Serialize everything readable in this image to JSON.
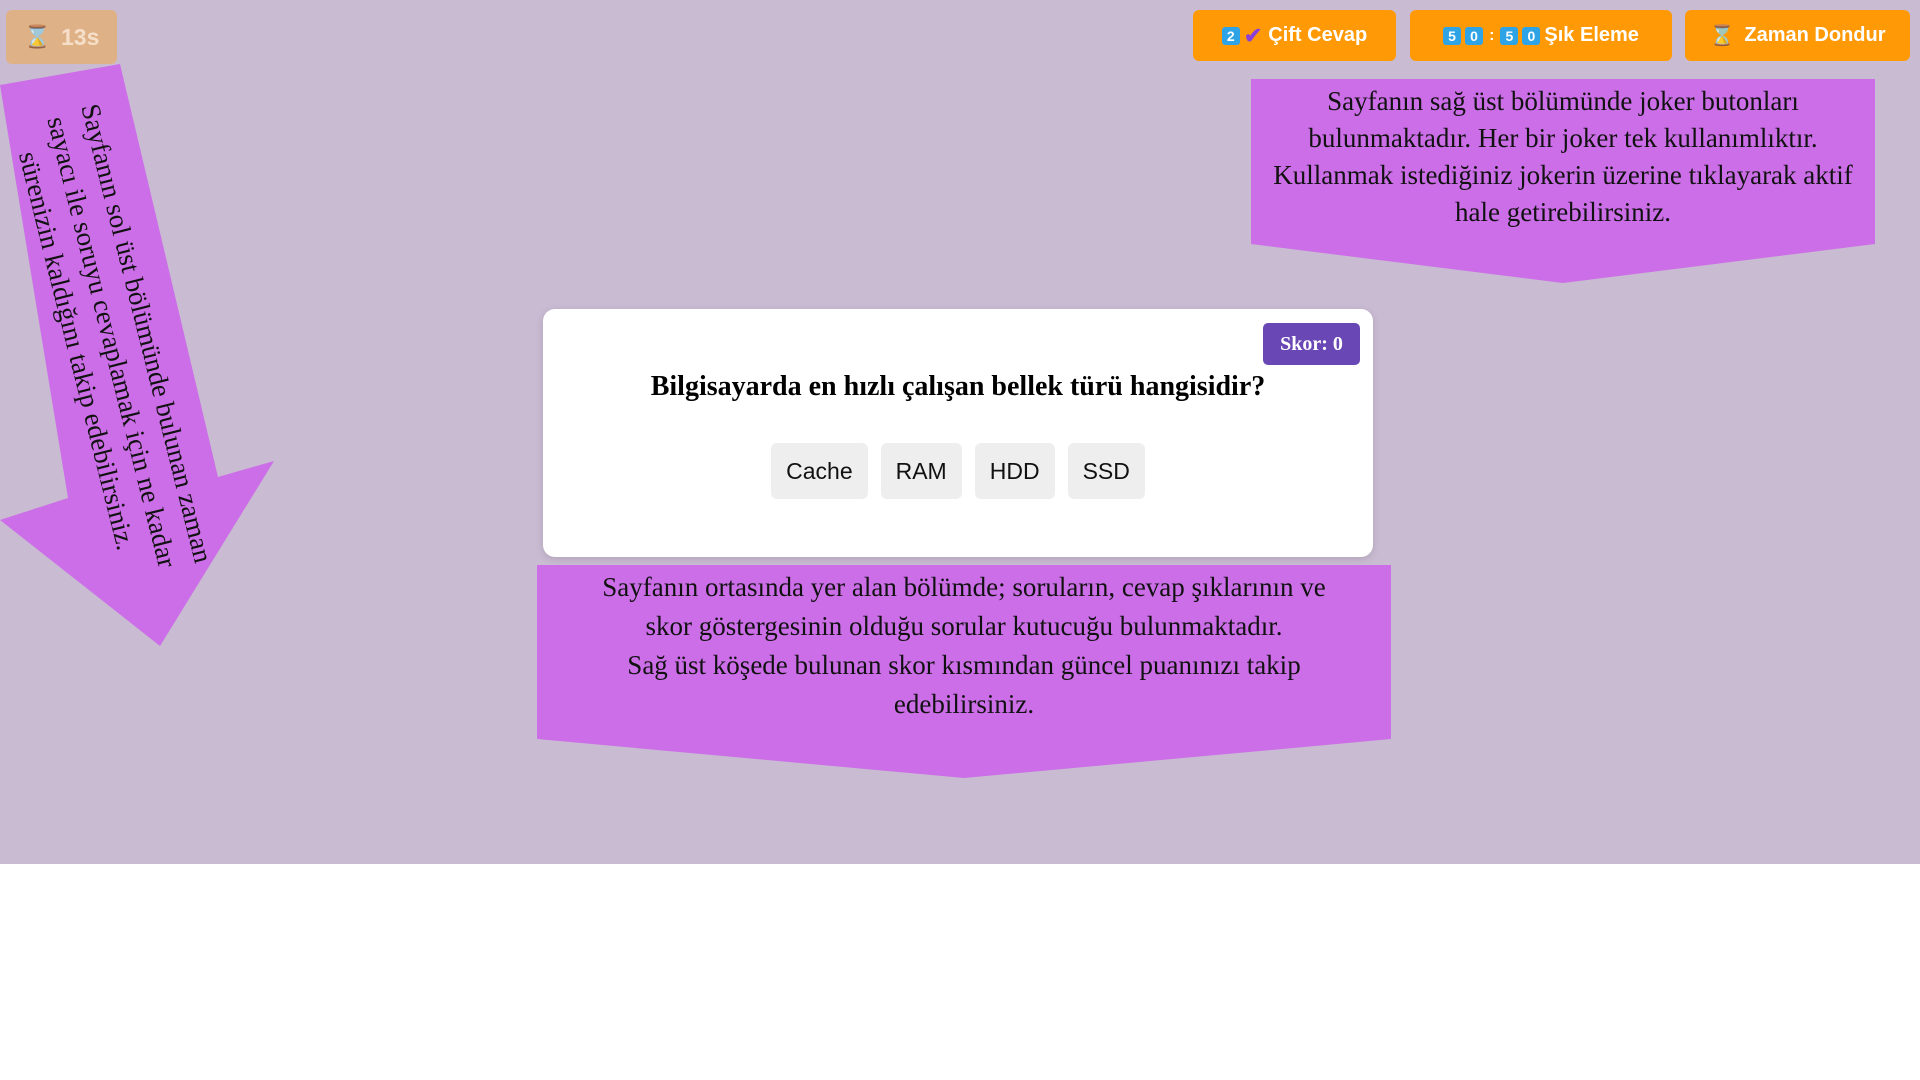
{
  "timer": {
    "icon": "hourglass-icon",
    "value": "13s"
  },
  "jokers": {
    "double_answer": {
      "digit": "2",
      "icon": "checkmark-icon",
      "label": "Çift Cevap"
    },
    "fifty_fifty": {
      "digits": [
        "5",
        "0",
        "5",
        "0"
      ],
      "separator": ":",
      "label": "Şık Eleme"
    },
    "freeze_time": {
      "icon": "hourglass-icon",
      "label": "Zaman Dondur"
    }
  },
  "callouts": {
    "top_right_lines": [
      "Sayfanın sağ üst bölümünde joker butonları",
      "bulunmaktadır. Her bir joker tek kullanımlıktır.",
      "Kullanmak istediğiniz jokerin üzerine tıklayarak aktif",
      "hale getirebilirsiniz."
    ],
    "left_lines": [
      "Sayfanın sol üst bölümünde bulunan zaman",
      "sayacı ile soruyu cevaplamak için ne kadar",
      "sürenizin kaldığını takip edebilirsiniz."
    ],
    "center_lines": [
      "Sayfanın ortasında yer alan bölümde; soruların, cevap şıklarının ve",
      "skor göstergesinin olduğu sorular kutucuğu bulunmaktadır.",
      "Sağ üst köşede bulunan skor kısmından güncel puanınızı takip",
      "edebilirsiniz."
    ]
  },
  "quiz": {
    "score_label": "Skor: 0",
    "question": "Bilgisayarda en hızlı çalışan bellek türü hangisidir?",
    "answers": [
      "Cache",
      "RAM",
      "HDD",
      "SSD"
    ]
  },
  "colors": {
    "background": "#c9bbd2",
    "joker": "#ff9a06",
    "callout": "#cc6ee8",
    "score_badge": "#6948b6",
    "digit_badge": "#2ea3e6"
  }
}
